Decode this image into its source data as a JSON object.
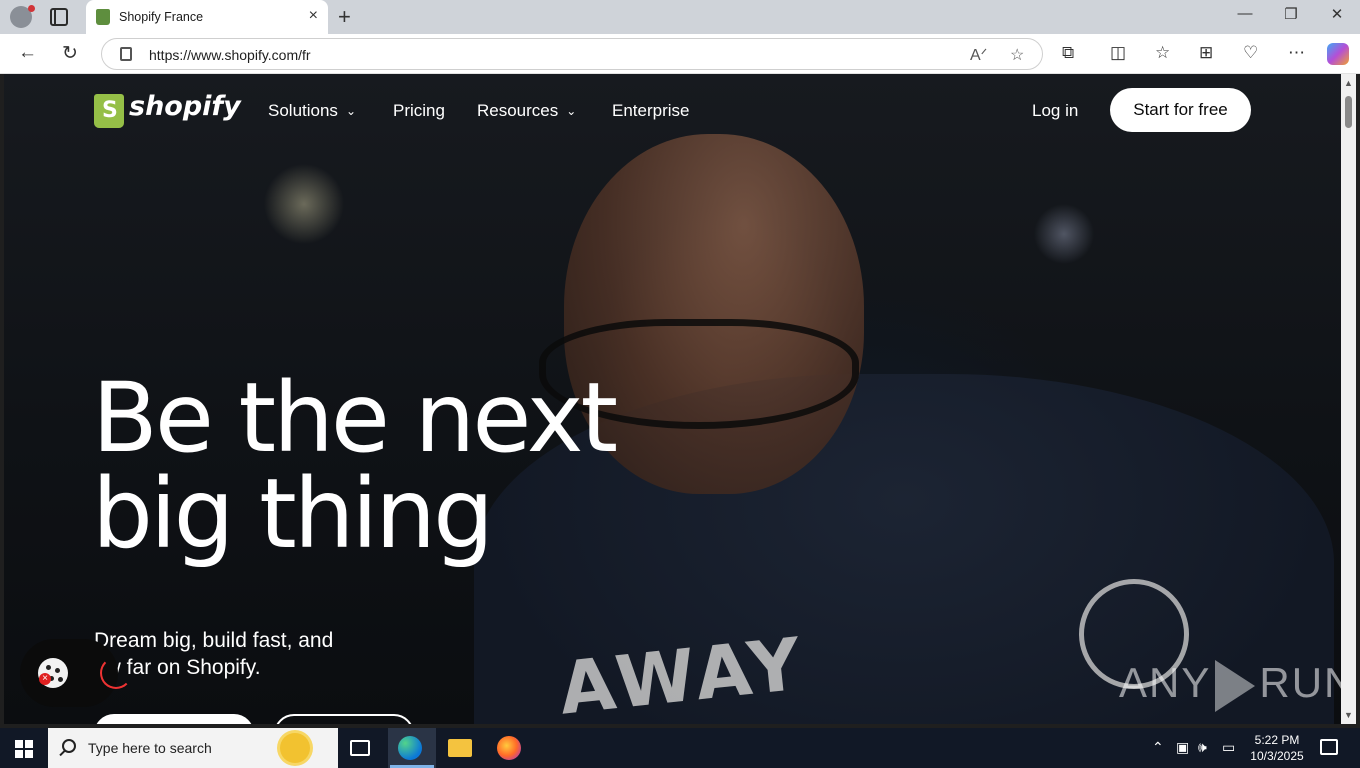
{
  "browser": {
    "tab_title": "Shopify France",
    "url": "https://www.shopify.com/fr",
    "new_tab_glyph": "+",
    "close_glyph": "×"
  },
  "site": {
    "logo_text": "shopify",
    "nav": {
      "solutions": "Solutions",
      "pricing": "Pricing",
      "resources": "Resources",
      "enterprise": "Enterprise"
    },
    "login": "Log in",
    "cta": "Start for free"
  },
  "hero": {
    "title_line1": "Be the next",
    "title_line2": "big thing",
    "subtitle_line1": "Dream big, build fast, and",
    "subtitle_line2": "ow far on Shopify."
  },
  "overlay": {
    "watermark_left": "ANY",
    "watermark_right": "RUN"
  },
  "taskbar": {
    "search_placeholder": "Type here to search",
    "time": "5:22 PM",
    "date": "10/3/2025"
  },
  "colors": {
    "brand_green": "#95bf47",
    "taskbar": "#111826"
  }
}
